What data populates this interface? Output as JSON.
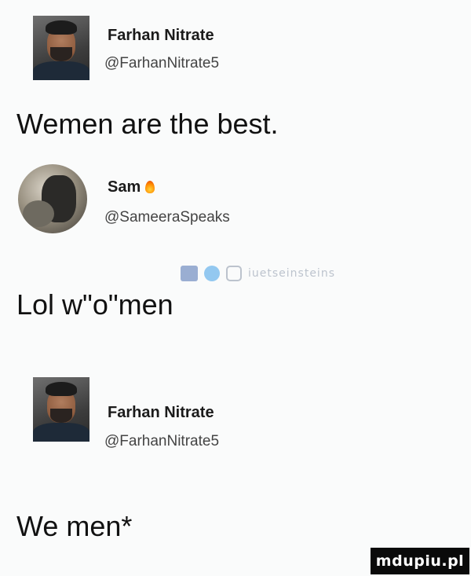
{
  "tweets": [
    {
      "author_name": "Farhan Nitrate",
      "author_handle": "@FarhanNitrate5",
      "text": "Wemen are the best."
    },
    {
      "author_name": "Sam",
      "author_handle": "@SameeraSpeaks",
      "author_badge_icon": "fire-icon",
      "text": "Lol w\"o\"men"
    },
    {
      "author_name": "Farhan Nitrate",
      "author_handle": "@FarhanNitrate5",
      "text": "We men*"
    }
  ],
  "watermark": {
    "icons": [
      "facebook-icon",
      "twitter-icon",
      "instagram-icon"
    ],
    "text": "iuetseinsteins"
  },
  "brand": "mdupiu.pl"
}
